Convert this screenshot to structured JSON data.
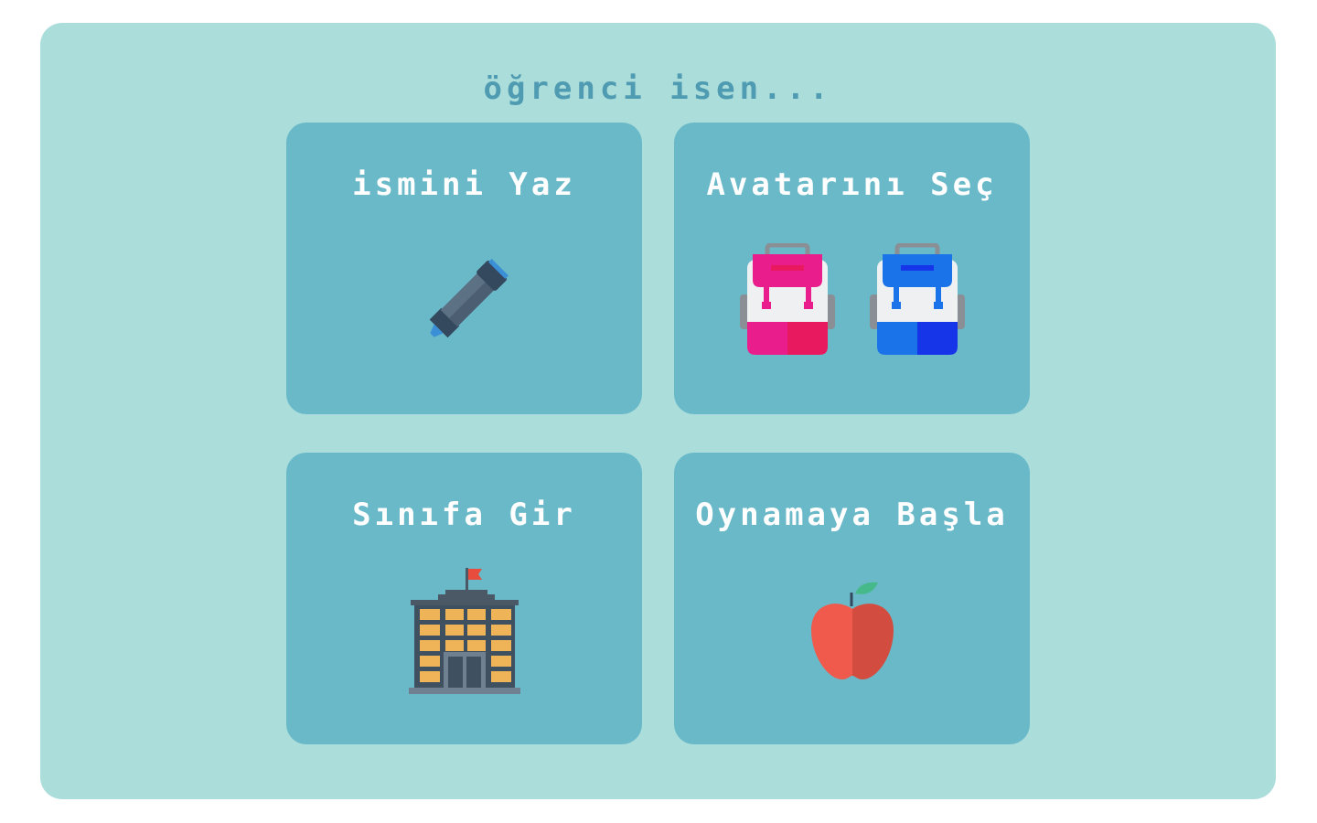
{
  "header": {
    "title": "öğrenci isen..."
  },
  "cards": [
    {
      "label": "ismini Yaz",
      "icon": "marker-pen-icon"
    },
    {
      "label": "Avatarını Seç",
      "icon": "backpack-icon"
    },
    {
      "label": "Sınıfa Gir",
      "icon": "school-building-icon"
    },
    {
      "label": "Oynamaya Başla",
      "icon": "apple-icon"
    }
  ],
  "avatars": [
    {
      "icon": "pink-backpack-icon",
      "color": "#e91e8c"
    },
    {
      "icon": "blue-backpack-icon",
      "color": "#1a73e8"
    }
  ],
  "colors": {
    "panel": "#abdddb",
    "card": "#69b9c8",
    "title": "#4f9bb1",
    "label": "#ffffff"
  }
}
